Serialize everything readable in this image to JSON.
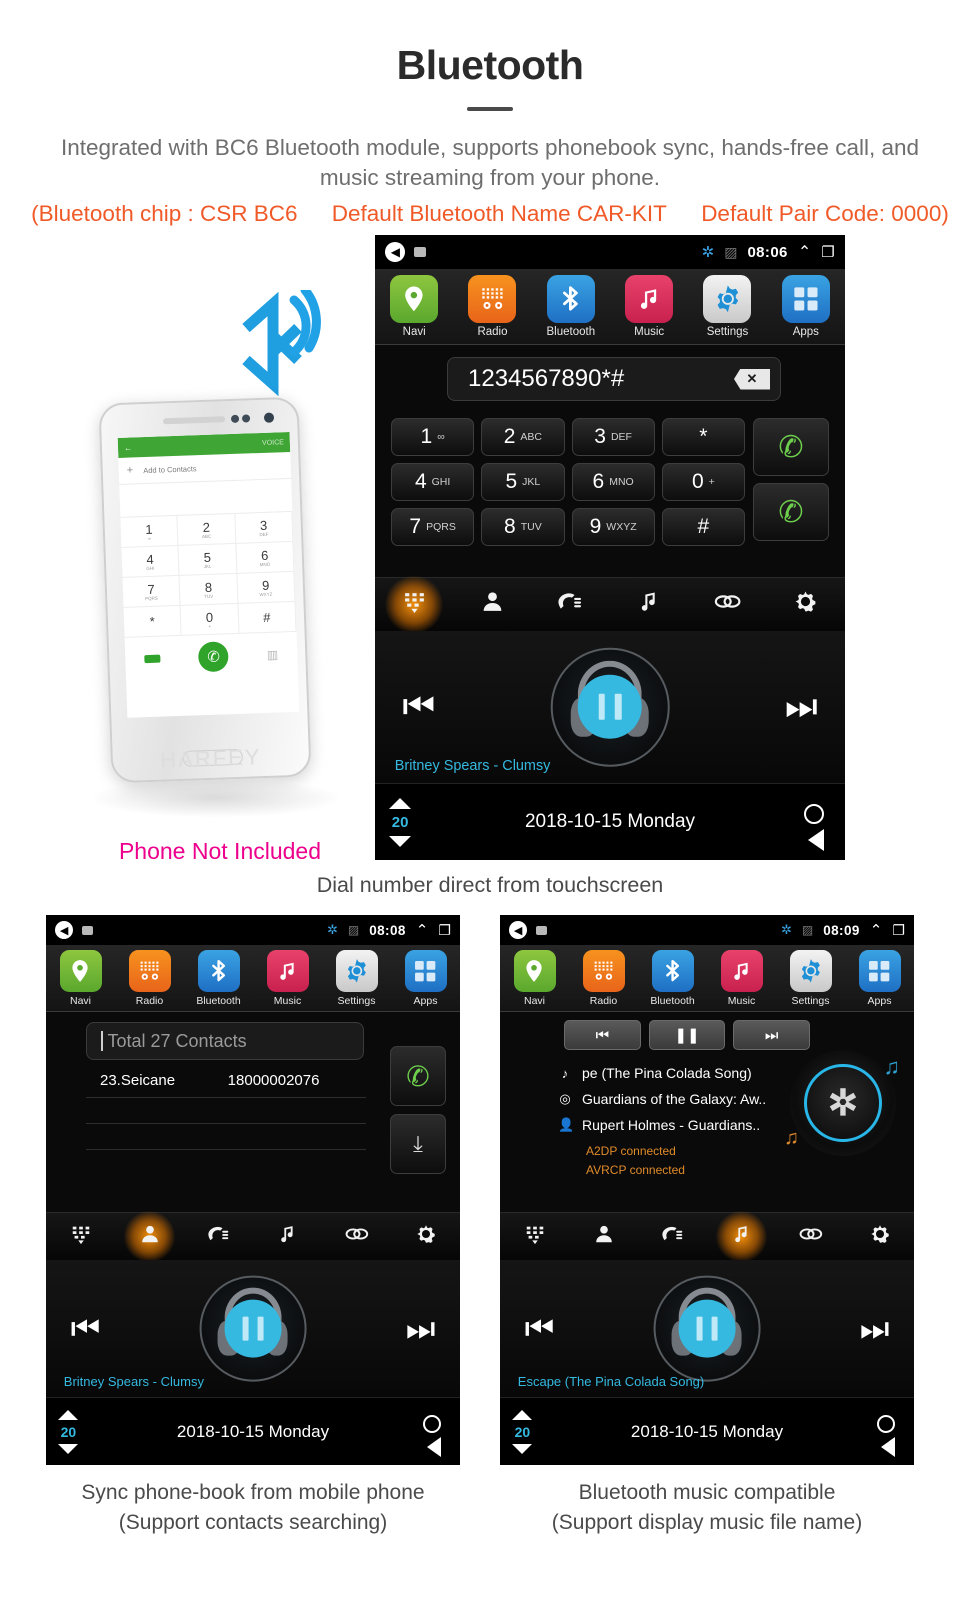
{
  "header": {
    "title": "Bluetooth",
    "subtitle": "Integrated with BC6 Bluetooth module, supports phonebook sync, hands-free call, and music streaming from your phone.",
    "spec_open": "(Bluetooth chip : CSR BC6",
    "spec_name": "Default Bluetooth Name CAR-KIT",
    "spec_pair": "Default Pair Code: 0000)",
    "accent_color": "#f05a28",
    "text_color": "#6e6e6e"
  },
  "phone_illustration": {
    "caption": "Phone Not Included",
    "caption_color": "#ec008c",
    "watermark": "HARFEY",
    "screen": {
      "add_to_contacts": "Add to Contacts",
      "voice_label": "VOICE",
      "keys": [
        {
          "digit": "1",
          "sub": "∞"
        },
        {
          "digit": "2",
          "sub": "ABC"
        },
        {
          "digit": "3",
          "sub": "DEF"
        },
        {
          "digit": "4",
          "sub": "GHI"
        },
        {
          "digit": "5",
          "sub": "JKL"
        },
        {
          "digit": "6",
          "sub": "MNO"
        },
        {
          "digit": "7",
          "sub": "PQRS"
        },
        {
          "digit": "8",
          "sub": "TUV"
        },
        {
          "digit": "9",
          "sub": "WXYZ"
        },
        {
          "digit": "*",
          "sub": ""
        },
        {
          "digit": "0",
          "sub": "+"
        },
        {
          "digit": "#",
          "sub": ""
        }
      ]
    }
  },
  "app_bar": {
    "items": [
      {
        "label": "Navi",
        "icon": "location-pin-icon",
        "color": "#7ac142"
      },
      {
        "label": "Radio",
        "icon": "radio-icon",
        "color": "#f1761c"
      },
      {
        "label": "Bluetooth",
        "icon": "bluetooth-icon",
        "color": "#2b8fdb"
      },
      {
        "label": "Music",
        "icon": "music-note-icon",
        "color": "#d9294f"
      },
      {
        "label": "Settings",
        "icon": "gear-icon",
        "color": "#dedede"
      },
      {
        "label": "Apps",
        "icon": "grid-apps-icon",
        "color": "#2b8fdb"
      }
    ]
  },
  "function_tabs": [
    {
      "name": "dialpad-tab",
      "icon": "keypad-icon"
    },
    {
      "name": "contacts-tab",
      "icon": "person-icon"
    },
    {
      "name": "call-history-tab",
      "icon": "call-history-icon"
    },
    {
      "name": "bt-music-tab",
      "icon": "music-note-icon"
    },
    {
      "name": "link-tab",
      "icon": "link-icon"
    },
    {
      "name": "settings-tab",
      "icon": "gear-icon"
    }
  ],
  "screen_dialer": {
    "status_bar": {
      "time": "08:06",
      "bluetooth_icon": "bluetooth-icon",
      "signal_icon": "no-sim-icon",
      "collapse_icon": "chevron-up-icon",
      "recents_icon": "recents-icon",
      "volume_icon": "volume-icon",
      "screenshot_icon": "screenshot-icon"
    },
    "dial_value": "1234567890*#",
    "backspace_icon": "backspace-icon",
    "keys": [
      {
        "digit": "1",
        "sub": "∞"
      },
      {
        "digit": "2",
        "sub": "ABC"
      },
      {
        "digit": "3",
        "sub": "DEF"
      },
      {
        "digit": "*",
        "sub": ""
      },
      {
        "digit": "4",
        "sub": "GHI"
      },
      {
        "digit": "5",
        "sub": "JKL"
      },
      {
        "digit": "6",
        "sub": "MNO"
      },
      {
        "digit": "0",
        "sub": "+"
      },
      {
        "digit": "7",
        "sub": "PQRS"
      },
      {
        "digit": "8",
        "sub": "TUV"
      },
      {
        "digit": "9",
        "sub": "WXYZ"
      },
      {
        "digit": "#",
        "sub": ""
      }
    ],
    "call_button_icon": "call-green-icon",
    "answer_button_icon": "call-answer-icon",
    "active_tab_index": 0,
    "player": {
      "song": "Britney Spears - Clumsy",
      "state": "pause",
      "prev_icon": "previous-track-icon",
      "next_icon": "next-track-icon",
      "play_icon": "pause-icon"
    },
    "bottom_bar": {
      "volume": "20",
      "date": "2018-10-15  Monday",
      "up_icon": "volume-up-icon",
      "down_icon": "volume-down-icon",
      "home_icon": "home-circle-icon",
      "back_icon": "back-triangle-icon"
    },
    "caption": "Dial number direct from touchscreen"
  },
  "screen_contacts": {
    "status_bar": {
      "time": "08:08"
    },
    "search_placeholder": "Total 27 Contacts",
    "contacts": [
      {
        "name": "23.Seicane",
        "number": "18000002076"
      }
    ],
    "call_button_icon": "call-green-icon",
    "download_button_icon": "download-contacts-icon",
    "active_tab_index": 1,
    "player": {
      "song": "Britney Spears - Clumsy"
    },
    "bottom_bar": {
      "volume": "20",
      "date": "2018-10-15  Monday"
    },
    "caption_line1": "Sync phone-book from mobile phone",
    "caption_line2": "(Support contacts searching)"
  },
  "screen_btmusic": {
    "status_bar": {
      "time": "08:09"
    },
    "transport": [
      {
        "name": "previous-button",
        "icon": "previous-track-icon"
      },
      {
        "name": "pause-button",
        "icon": "pause-icon"
      },
      {
        "name": "next-button",
        "icon": "next-track-icon"
      }
    ],
    "metadata": [
      {
        "icon": "music-note-icon",
        "text": "pe (The Pina Colada Song)"
      },
      {
        "icon": "disc-icon",
        "text": "Guardians of the Galaxy: Aw.."
      },
      {
        "icon": "person-icon",
        "text": "Rupert Holmes - Guardians.."
      }
    ],
    "status_lines": [
      "A2DP  connected",
      "AVRCP connected"
    ],
    "status_color": "#e08b2a",
    "disc_icon": "bluetooth-disc-icon",
    "active_tab_index": 3,
    "player": {
      "song": "Escape (The Pina Colada Song)"
    },
    "bottom_bar": {
      "volume": "20",
      "date": "2018-10-15  Monday"
    },
    "caption_line1": "Bluetooth music compatible",
    "caption_line2": "(Support display music file name)"
  }
}
